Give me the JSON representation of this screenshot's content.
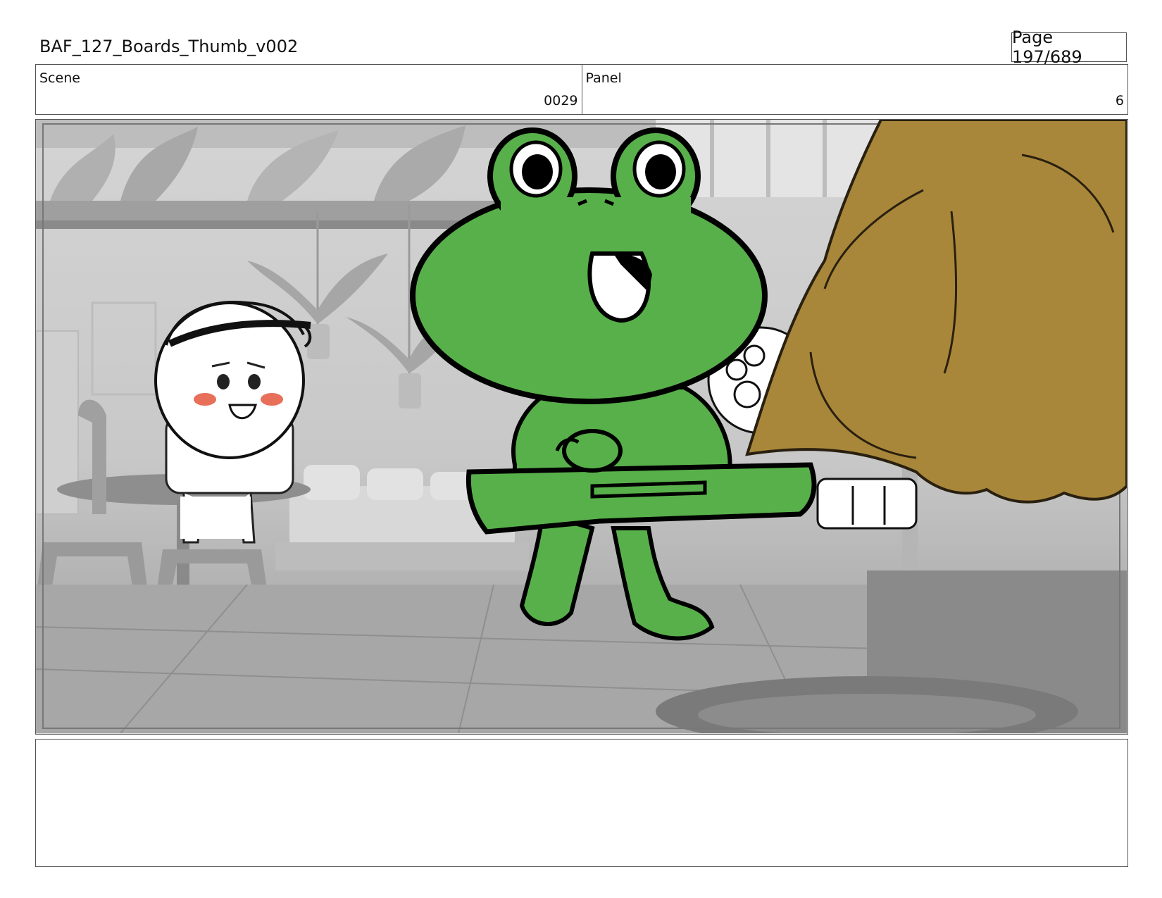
{
  "header": {
    "title": "BAF_127_Boards_Thumb_v002",
    "page": "Page 197/689"
  },
  "info": {
    "scene_label": "Scene",
    "scene_value": "0029",
    "panel_label": "Panel",
    "panel_value": "6"
  },
  "colors": {
    "frog": "#58b04a",
    "bear": "#a8873a",
    "outline": "#000000",
    "blush": "#e8705a"
  },
  "notes": {
    "text": ""
  }
}
